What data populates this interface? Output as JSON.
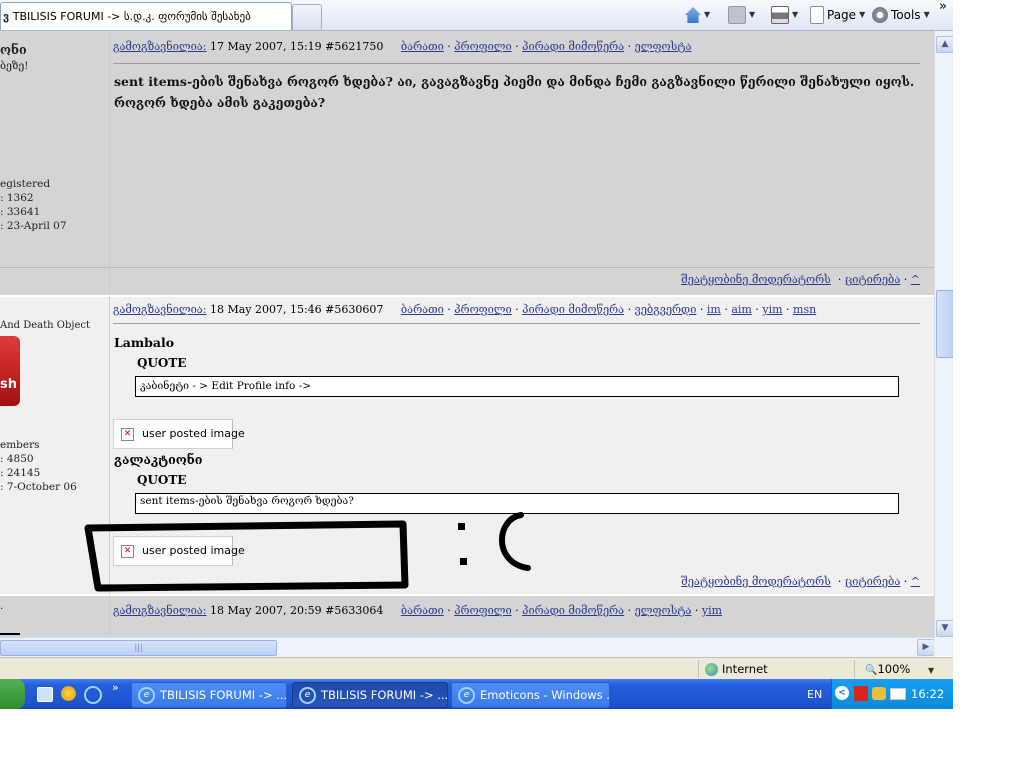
{
  "browser": {
    "tab_number": "ვ",
    "tab_title": "TBILISIS FORUMI -> ს.დ.კ. ფორუმის შესახებ",
    "page_label": "Page",
    "tools_label": "Tools",
    "chevron": "»"
  },
  "posts": [
    {
      "author_partial": "ონი",
      "sub_partial": "ბეზე!",
      "header": {
        "posted_label": "გამოგზავნილია:",
        "date": "17 May 2007, 15:19",
        "post_no": "#5621750",
        "links": [
          "ბარათი",
          "პროფილი",
          "პირადი მიმოწერა",
          "ელფოსტა"
        ]
      },
      "text": "sent items-ების შენახვა როგორ ხდება? აი, გავაგზავნე პიემი და მინდა ჩემი გაგზავნილი წერილი შენახული იყოს. როგორ ხდება ამის გაკეთება?",
      "side": [
        "egistered",
        ": 1362",
        ": 33641",
        ": 23-April 07"
      ],
      "footer": {
        "report": "შეატყობინე მოდერატორს",
        "quote": "ციტირება",
        "top": "^"
      }
    },
    {
      "title_partial": "And Death Object",
      "avatar_text": "sh",
      "header": {
        "posted_label": "გამოგზავნილია:",
        "date": "18 May 2007, 15:46",
        "post_no": "#5630607",
        "links": [
          "ბარათი",
          "პროფილი",
          "პირადი მიმოწერა",
          "ვებგვერდი",
          "im",
          "aim",
          "yim",
          "msn"
        ]
      },
      "quote1_author": "Lambalo",
      "quote_label": "QUOTE",
      "quote1_text": "კაბინეტი - > Edit Profile info ->",
      "image_placeholder": "user posted image",
      "quote2_author": "გალაკტიონი",
      "quote2_text": "sent items-ების შენახვა როგორ ხდება?",
      "side": [
        "embers",
        ": 4850",
        ": 24145",
        ": 7-October 06"
      ],
      "footer": {
        "report": "შეატყობინე მოდერატორს",
        "quote": "ციტირება",
        "top": "^"
      }
    },
    {
      "header": {
        "posted_label": "გამოგზავნილია:",
        "date": "18 May 2007, 20:59",
        "post_no": "#5633064",
        "links": [
          "ბარათი",
          "პროფილი",
          "პირადი მიმოწერა",
          "ელფოსტა",
          "yim"
        ]
      },
      "side_partial": "."
    }
  ],
  "status": {
    "zone": "Internet",
    "zoom": "100%"
  },
  "taskbar": {
    "windows": [
      "TBILISIS FORUMI -> ...",
      "TBILISIS FORUMI -> ...",
      "Emoticons - Windows ..."
    ],
    "lang": "EN",
    "clock": "16:22"
  },
  "colors": {
    "post_bg_1": "#d4d4d4",
    "post_bg_2": "#f0f0f0",
    "link": "#2a3a8f",
    "taskbar": "#245edb"
  }
}
